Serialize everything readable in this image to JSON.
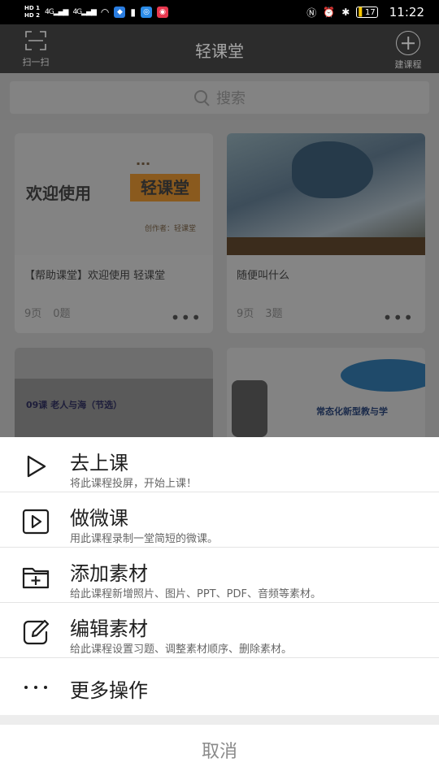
{
  "status_bar": {
    "hd1": "HD 1",
    "hd2": "HD 2",
    "signal1": "4G",
    "signal2": "4G",
    "battery": "17",
    "time": "11:22"
  },
  "nav": {
    "scan_label": "扫一扫",
    "title": "轻课堂",
    "add_label": "建课程"
  },
  "search": {
    "placeholder": "搜索"
  },
  "courses": [
    {
      "thumb_main": "欢迎使用",
      "thumb_brand": "轻课堂",
      "thumb_author": "创作者：轻课堂",
      "title": "【帮助课堂】欢迎使用 轻课堂",
      "pages": "9页",
      "questions": "0题"
    },
    {
      "title": "随便叫什么",
      "pages": "9页",
      "questions": "3题"
    },
    {
      "thumb_text": "09课  老人与海（节选）"
    },
    {
      "thumb_text": "常态化新型教与学"
    }
  ],
  "more_glyph": "•••",
  "actions": [
    {
      "title": "去上课",
      "desc": "将此课程投屏，开始上课！",
      "icon": "play-icon"
    },
    {
      "title": "做微课",
      "desc": "用此课程录制一堂简短的微课。",
      "icon": "video-play-icon"
    },
    {
      "title": "添加素材",
      "desc": "给此课程新增照片、图片、PPT、PDF、音频等素材。",
      "icon": "folder-add-icon"
    },
    {
      "title": "编辑素材",
      "desc": "给此课程设置习题、调整素材顺序、删除素材。",
      "icon": "edit-icon"
    },
    {
      "title": "更多操作",
      "icon": "more-icon"
    }
  ],
  "cancel_label": "取消",
  "colors": {
    "overlay": "#7b7b7b",
    "sheet_bg": "#ffffff",
    "text_primary": "#1e1e1e",
    "text_secondary": "#666666"
  }
}
